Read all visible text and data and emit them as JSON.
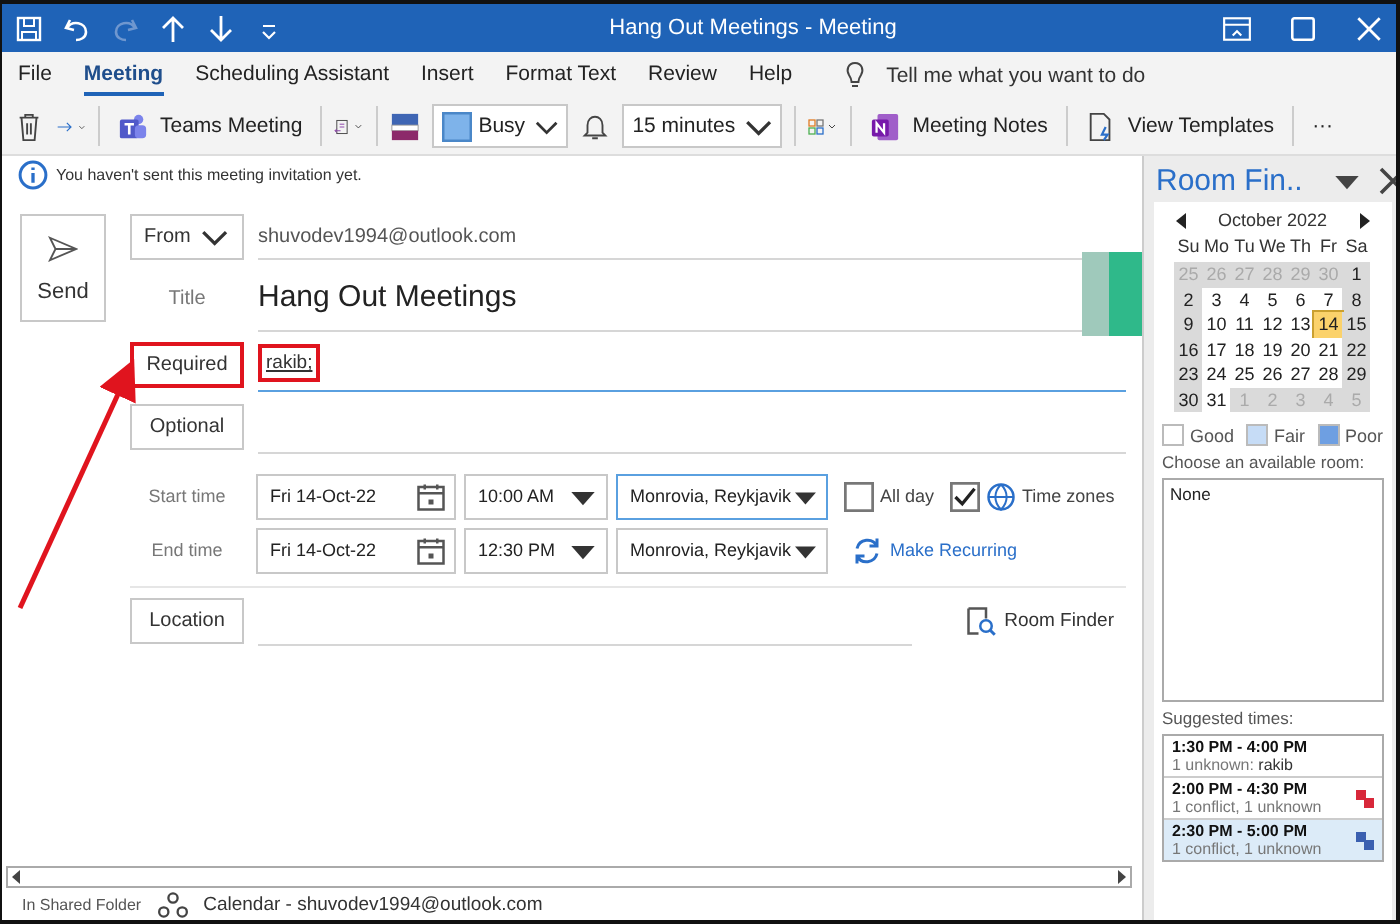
{
  "window": {
    "title": "Hang Out Meetings  -  Meeting"
  },
  "menu": [
    {
      "label": "File",
      "selected": false
    },
    {
      "label": "Meeting",
      "selected": true
    },
    {
      "label": "Scheduling Assistant",
      "selected": false
    },
    {
      "label": "Insert",
      "selected": false
    },
    {
      "label": "Format Text",
      "selected": false
    },
    {
      "label": "Review",
      "selected": false
    },
    {
      "label": "Help",
      "selected": false
    }
  ],
  "tell_me": {
    "placeholder": "Tell me what you want to do"
  },
  "toolbar": {
    "teams": "Teams Meeting",
    "show_as": "Busy",
    "reminder": "15 minutes",
    "meeting_notes": "Meeting Notes",
    "view_templates": "View Templates",
    "more": "···"
  },
  "info": "You haven't sent this meeting invitation yet.",
  "form": {
    "send": "Send",
    "from_button": "From",
    "from_value": "shuvodev1994@outlook.com",
    "title_label": "Title",
    "title_value": "Hang Out Meetings",
    "required_button": {
      "label": "Required",
      "highlighted": true
    },
    "required_value": {
      "text": "rakib;",
      "highlighted": true
    },
    "optional_button": "Optional",
    "start_label": "Start time",
    "start_date": "Fri 14-Oct-22",
    "start_time": "10:00 AM",
    "start_zone": "Monrovia, Reykjavik",
    "all_day": {
      "label": "All day",
      "checked": false
    },
    "time_zones": {
      "label": "Time zones",
      "checked": true
    },
    "end_label": "End time",
    "end_date": "Fri 14-Oct-22",
    "end_time": "12:30 PM",
    "end_zone": "Monrovia, Reykjavik",
    "make_recurring": "Make Recurring",
    "location_button": "Location",
    "room_finder": "Room Finder"
  },
  "room_finder_pane": {
    "title": "Room Fin..",
    "month": "October 2022",
    "weekdays": [
      "Su",
      "Mo",
      "Tu",
      "We",
      "Th",
      "Fr",
      "Sa"
    ],
    "weeks": [
      [
        {
          "day": "25",
          "outside": true,
          "selected": false
        },
        {
          "day": "26",
          "outside": true,
          "selected": false
        },
        {
          "day": "27",
          "outside": true,
          "selected": false
        },
        {
          "day": "28",
          "outside": true,
          "selected": false
        },
        {
          "day": "29",
          "outside": true,
          "selected": false
        },
        {
          "day": "30",
          "outside": true,
          "selected": false
        },
        {
          "day": "1",
          "outside": false,
          "selected": false
        }
      ],
      [
        {
          "day": "2",
          "outside": false,
          "selected": false
        },
        {
          "day": "3",
          "outside": false,
          "selected": false
        },
        {
          "day": "4",
          "outside": false,
          "selected": false
        },
        {
          "day": "5",
          "outside": false,
          "selected": false
        },
        {
          "day": "6",
          "outside": false,
          "selected": false
        },
        {
          "day": "7",
          "outside": false,
          "selected": false
        },
        {
          "day": "8",
          "outside": false,
          "selected": false
        }
      ],
      [
        {
          "day": "9",
          "outside": false,
          "selected": false
        },
        {
          "day": "10",
          "outside": false,
          "selected": false
        },
        {
          "day": "11",
          "outside": false,
          "selected": false
        },
        {
          "day": "12",
          "outside": false,
          "selected": false
        },
        {
          "day": "13",
          "outside": false,
          "selected": false
        },
        {
          "day": "14",
          "outside": false,
          "selected": true
        },
        {
          "day": "15",
          "outside": false,
          "selected": false
        }
      ],
      [
        {
          "day": "16",
          "outside": false,
          "selected": false
        },
        {
          "day": "17",
          "outside": false,
          "selected": false
        },
        {
          "day": "18",
          "outside": false,
          "selected": false
        },
        {
          "day": "19",
          "outside": false,
          "selected": false
        },
        {
          "day": "20",
          "outside": false,
          "selected": false
        },
        {
          "day": "21",
          "outside": false,
          "selected": false
        },
        {
          "day": "22",
          "outside": false,
          "selected": false
        }
      ],
      [
        {
          "day": "23",
          "outside": false,
          "selected": false
        },
        {
          "day": "24",
          "outside": false,
          "selected": false
        },
        {
          "day": "25",
          "outside": false,
          "selected": false
        },
        {
          "day": "26",
          "outside": false,
          "selected": false
        },
        {
          "day": "27",
          "outside": false,
          "selected": false
        },
        {
          "day": "28",
          "outside": false,
          "selected": false
        },
        {
          "day": "29",
          "outside": false,
          "selected": false
        }
      ],
      [
        {
          "day": "30",
          "outside": false,
          "selected": false
        },
        {
          "day": "31",
          "outside": false,
          "selected": false
        },
        {
          "day": "1",
          "outside": true,
          "selected": false
        },
        {
          "day": "2",
          "outside": true,
          "selected": false
        },
        {
          "day": "3",
          "outside": true,
          "selected": false
        },
        {
          "day": "4",
          "outside": true,
          "selected": false
        },
        {
          "day": "5",
          "outside": true,
          "selected": false
        }
      ]
    ],
    "legend": [
      {
        "label": "Good",
        "color": "#ffffff"
      },
      {
        "label": "Fair",
        "color": "#c6dcf6"
      },
      {
        "label": "Poor",
        "color": "#6e9fe2"
      }
    ],
    "rooms_label": "Choose an available room:",
    "rooms": [
      "None"
    ],
    "suggested_label": "Suggested times:",
    "suggested": [
      {
        "time": "1:30 PM - 4:00 PM",
        "detail": "1 unknown:",
        "name": "rakib",
        "conflict": false,
        "selected": false
      },
      {
        "time": "2:00 PM - 4:30 PM",
        "detail": "1 conflict, 1 unknown",
        "conflict": true,
        "selected": false
      },
      {
        "time": "2:30 PM - 5:00 PM",
        "detail": "1 conflict, 1 unknown",
        "conflict": true,
        "selected": true
      }
    ]
  },
  "status_bar": {
    "folder_label": "In Shared Folder",
    "calendar": "Calendar - shuvodev1994@outlook.com"
  }
}
